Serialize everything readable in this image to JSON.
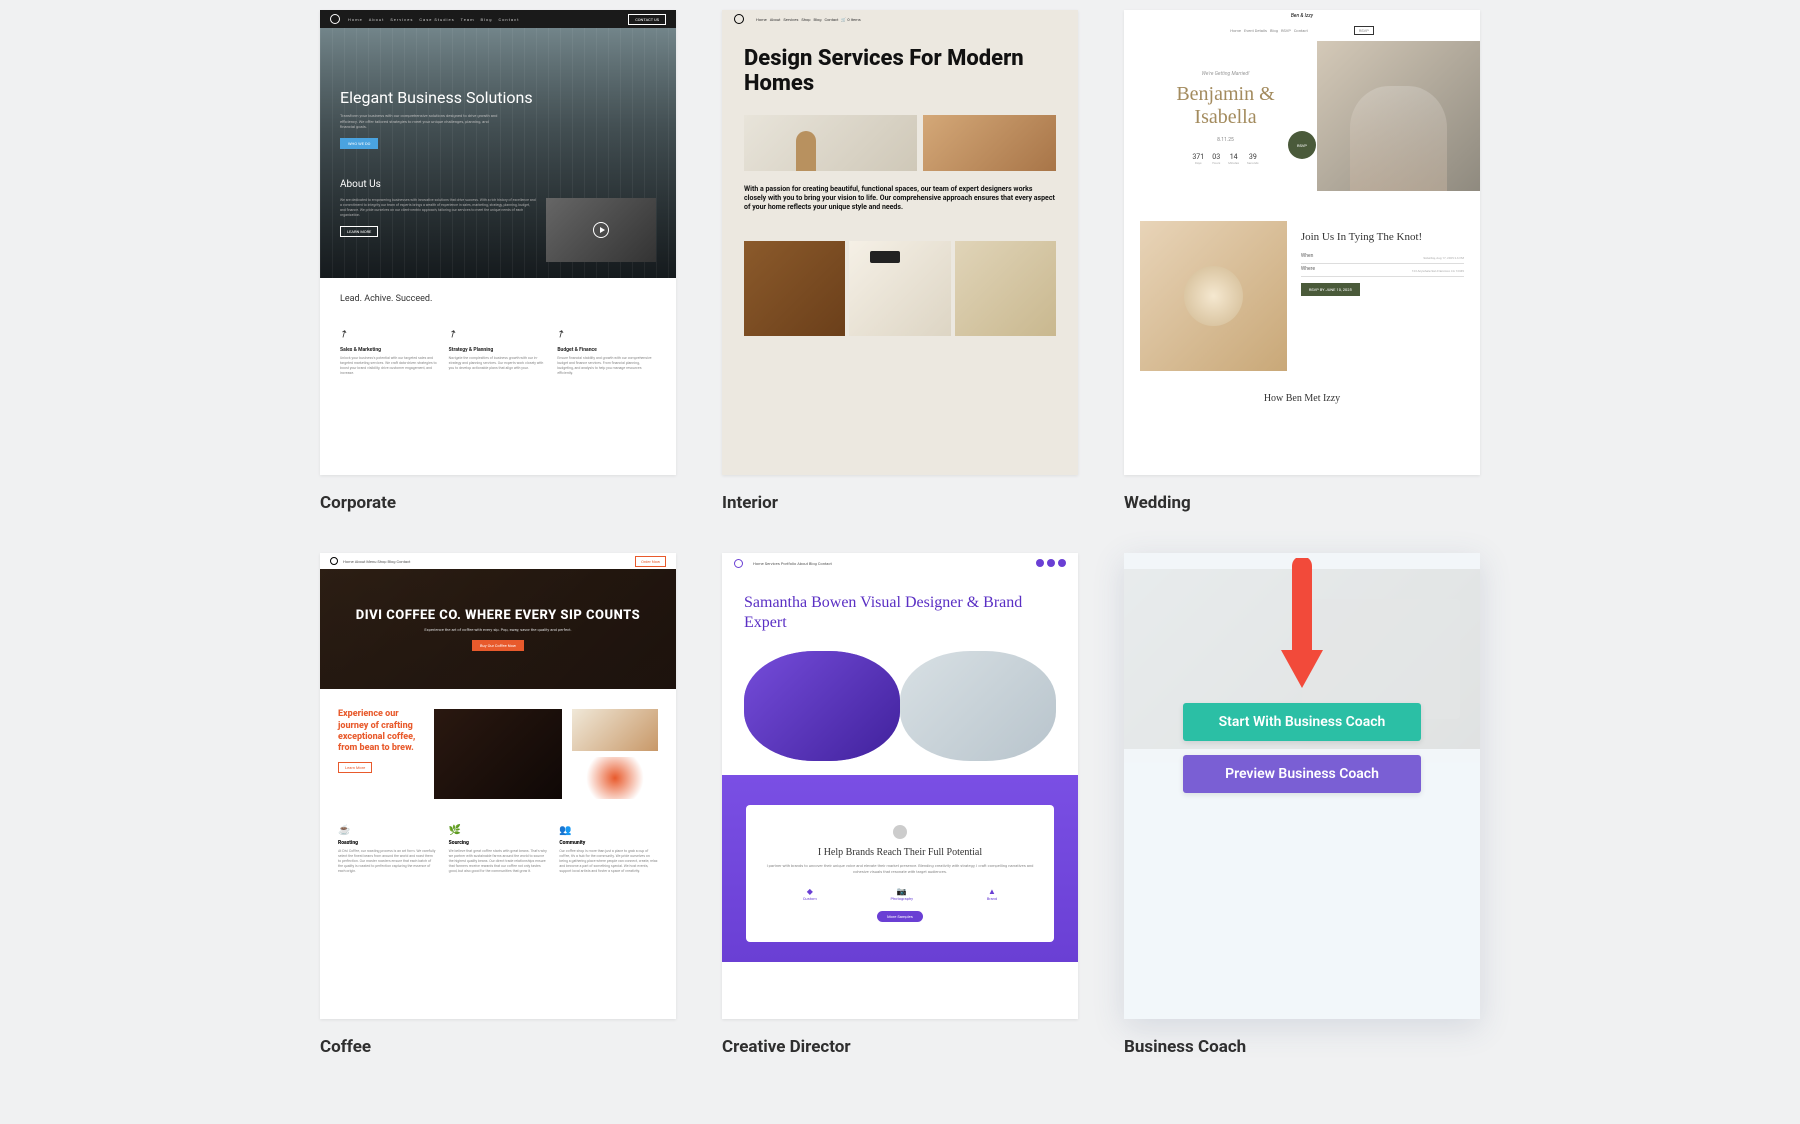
{
  "templates": [
    {
      "name": "Corporate",
      "content": {
        "nav": [
          "Home",
          "About",
          "Services",
          "Case Studies",
          "Team",
          "Blog",
          "Contact"
        ],
        "nav_cta": "CONTACT US",
        "hero_title": "Elegant Business Solutions",
        "hero_sub": "Transform your business with our comprehensive solutions designed to drive growth and efficiency. We offer tailored strategies to meet your unique challenges, planning, and financial goals.",
        "hero_cta": "WHO WE DO",
        "about_h": "About Us",
        "about_p": "We are dedicated to empowering businesses with innovative solutions that drive success. With a rich history of excellence and a commitment to integrity our team of experts brings a wealth of experience in sales, marketing, strategy, planning, budget, and finance. We pride ourselves on our client-centric approach, tailoring our services to meet the unique needs of each organization.",
        "learn_more": "LEARN MORE",
        "lead": "Lead. Achive. Succeed.",
        "cols": [
          {
            "h": "Sales & Marketing",
            "p": "Unlock your business's potential with our targeted sales and targeted marketing services. We craft data-driven strategies to boost your brand visibility, drive customer engagement, and increase."
          },
          {
            "h": "Strategy & Planning",
            "p": "Navigate the complexities of business growth with our in-strategy and planning services. Our experts work closely with you to develop actionable plans that align with your."
          },
          {
            "h": "Budget & Finance",
            "p": "Ensure financial stability and growth with our comprehensive budget and finance services. From financial planning, budgeting, and analysis to help you manage resources efficiently."
          }
        ]
      }
    },
    {
      "name": "Interior",
      "content": {
        "nav": [
          "Home",
          "About",
          "Services",
          "Shop",
          "Blog",
          "Contact",
          "0 Items"
        ],
        "h1": "Design Services For Modern Homes",
        "p": "With a passion for creating beautiful, functional spaces, our team of expert designers works closely with you to bring your vision to life. Our comprehensive approach ensures that every aspect of your home reflects your unique style and needs."
      }
    },
    {
      "name": "Wedding",
      "content": {
        "brand": "Ben & Izzy",
        "nav": [
          "Home",
          "Event Details",
          "Blog",
          "RSVP",
          "Contact"
        ],
        "married": "We're Getting Married!",
        "names": "Benjamin & Isabella",
        "date": "8.11.25",
        "countdown": [
          {
            "n": "371",
            "l": "Days"
          },
          {
            "n": "03",
            "l": "Hours"
          },
          {
            "n": "14",
            "l": "Minutes"
          },
          {
            "n": "39",
            "l": "Seconds"
          }
        ],
        "rsvp": "RSVP",
        "join": "Join Us In Tying The Knot!",
        "when": "When",
        "when_detail": "Saturday, Aug 17, 2025\n2-6 PM",
        "where": "Where",
        "where_detail": "123 Anywhere\nSan Francisco CA 12345",
        "btn": "RSVP BY JUNE 10, 2025",
        "how": "How Ben Met Izzy"
      }
    },
    {
      "name": "Coffee",
      "content": {
        "nav": [
          "Home",
          "About",
          "Menu",
          "Shop",
          "Blog",
          "Contact"
        ],
        "nav_cta": "Order Now",
        "h1": "DIVI COFFEE CO. WHERE EVERY SIP COUNTS",
        "sub": "Experience the art of coffee with every sip. Pop, sway, savor the quality and perfect.",
        "cta": "Buy Our Coffee Now",
        "exp_h": "Experience our journey of crafting exceptional coffee, from bean to brew.",
        "exp_btn": "Learn More",
        "feat": [
          {
            "icon": "☕",
            "h": "Roasting",
            "p": "At Divi Coffee, our roasting process is an art form. We carefully select the finest beans from around the world and roast them to perfection. Our master roasters ensure that each batch of the quality is roasted to perfection capturing the essence of each origin."
          },
          {
            "icon": "🌿",
            "h": "Sourcing",
            "p": "We believe that great coffee starts with great beans. That's why we partner with sustainable farms around the world to source the highest quality beans. Our direct trade relationships ensure that farmers receive rewards that our coffee not only tastes good, but also good for the communities that grow it."
          },
          {
            "icon": "👥",
            "h": "Community",
            "p": "Our coffee shop is more than just a place to grab a cup of coffee, it's a hub for the community. We pride ourselves on being a gathering place where people can connect, create, relax and become a part of something special.\nWe host events, support local artists and foster a space of creativity."
          }
        ]
      }
    },
    {
      "name": "Creative Director",
      "content": {
        "nav": [
          "Home",
          "Services",
          "Portfolio",
          "About",
          "Blog",
          "Contact"
        ],
        "h1": "Samantha Bowen Visual Designer & Brand Expert",
        "help": "I Help Brands Reach Their Full Potential",
        "help_p": "I partner with brands to uncover their unique voice and elevate their market presence. Blending creativity with strategy, I craft compelling narratives and cohesive visuals that resonate with target audiences.",
        "icons": [
          {
            "glyph": "◆",
            "label": "Custom"
          },
          {
            "glyph": "📷",
            "label": "Photography"
          },
          {
            "glyph": "▲",
            "label": "Brand"
          }
        ],
        "samples": "More Samples"
      }
    },
    {
      "name": "Business Coach",
      "hover": {
        "start": "Start With Business Coach",
        "preview": "Preview Business Coach"
      }
    }
  ]
}
